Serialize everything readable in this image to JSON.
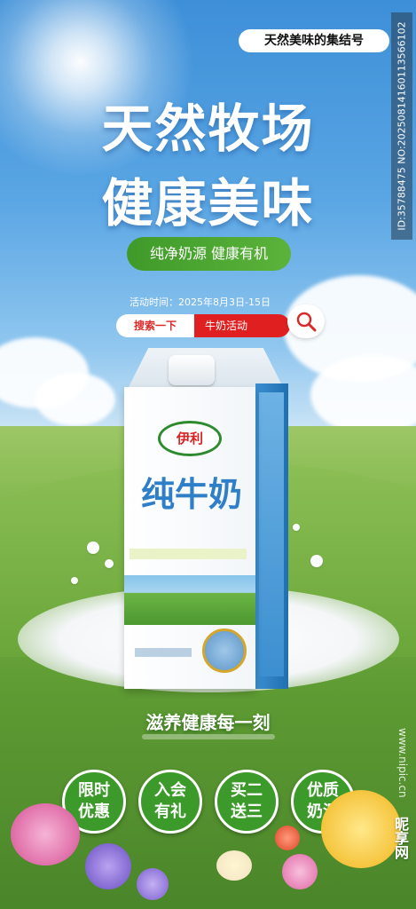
{
  "top_tag": "天然美味的集结号",
  "side_id": "ID:35788475 NO:20250814160113566102",
  "title_line1": "天然牧场",
  "title_line2": "健康美味",
  "green_pill": "纯净奶源 健康有机",
  "event_date": "活动时间：2025年8月3日-15日",
  "search": {
    "left": "搜索一下",
    "right": "牛奶活动"
  },
  "carton": {
    "brand": "伊利",
    "product": "纯牛奶"
  },
  "slogan": "滋养健康每一刻",
  "badges": [
    {
      "line1": "限时",
      "line2": "优惠"
    },
    {
      "line1": "入会",
      "line2": "有礼"
    },
    {
      "line1": "买二",
      "line2": "送三"
    },
    {
      "line1": "优质",
      "line2": "奶源"
    }
  ],
  "watermark_url": "www.nipic.cn",
  "watermark_logo": "昵享网",
  "colors": {
    "green": "#3c9a2a",
    "red": "#e02020",
    "sky": "#3d8fd8"
  }
}
